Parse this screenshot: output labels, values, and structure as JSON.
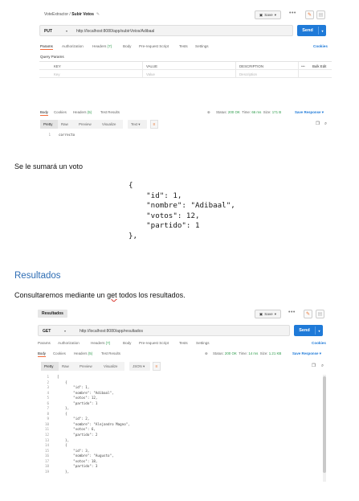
{
  "shot1": {
    "tab_collection": "VoteExtractor",
    "tab_separator": " / ",
    "tab_request": "Subir Votos",
    "save_label": "Save",
    "method": "PUT",
    "url": "http://localhost:8080/app/subirVotos/Adibaal",
    "send_label": "Send",
    "req_tabs": [
      "Params",
      "Authorization",
      "Headers",
      "Body",
      "Pre-request Script",
      "Tests",
      "Settings"
    ],
    "headers_count": "(7)",
    "cookies_label": "Cookies",
    "query_params_label": "Query Params",
    "table_headers": [
      "KEY",
      "VALUE",
      "DESCRIPTION"
    ],
    "bulk_edit": "Bulk Edit",
    "table_placeholders": [
      "Key",
      "Value",
      "Description"
    ],
    "res_tabs": [
      "Body",
      "Cookies",
      "Headers",
      "Test Results"
    ],
    "res_headers_count": "(5)",
    "status_label": "Status:",
    "status_value": "200 OK",
    "time_label": "Time:",
    "time_value": "66 ms",
    "size_label": "Size:",
    "size_value": "171 B",
    "save_response": "Save Response",
    "view_tabs": [
      "Pretty",
      "Raw",
      "Preview",
      "Visualize"
    ],
    "format": "Text",
    "code_line_no": "1",
    "code_line_text": "correcto"
  },
  "doc": {
    "line1": "Se le sumará un voto",
    "json_lines": [
      "{",
      "    \"id\": 1,",
      "    \"nombre\": \"Adibaal\",",
      "    \"votos\": 12,",
      "    \"partido\": 1",
      "},"
    ],
    "heading": "Resultados",
    "para_before": "Consultaremos mediante un ",
    "para_get": "get",
    "para_after": " todos los resultados."
  },
  "shot2": {
    "tab_request": "Resultados",
    "save_label": "Save",
    "method": "GET",
    "url": "http://localhost:8080/app/resultados",
    "send_label": "Send",
    "req_tabs": [
      "Params",
      "Authorization",
      "Headers",
      "Body",
      "Pre-request Script",
      "Tests",
      "Settings"
    ],
    "headers_count": "(7)",
    "cookies_label": "Cookies",
    "res_tabs": [
      "Body",
      "Cookies",
      "Headers",
      "Test Results"
    ],
    "res_headers_count": "(5)",
    "status_label": "Status:",
    "status_value": "200 OK",
    "time_label": "Time:",
    "time_value": "14 ms",
    "size_label": "Size:",
    "size_value": "1.21 KB",
    "save_response": "Save Response",
    "view_tabs": [
      "Pretty",
      "Raw",
      "Preview",
      "Visualize"
    ],
    "format": "JSON",
    "code_lines": [
      {
        "n": "1",
        "t": "["
      },
      {
        "n": "2",
        "t": "    {"
      },
      {
        "n": "3",
        "t": "        \"id\": 1,"
      },
      {
        "n": "4",
        "t": "        \"nombre\": \"Adibaal\","
      },
      {
        "n": "5",
        "t": "        \"votos\": 12,"
      },
      {
        "n": "6",
        "t": "        \"partido\": 1"
      },
      {
        "n": "7",
        "t": "    },"
      },
      {
        "n": "8",
        "t": "    {"
      },
      {
        "n": "9",
        "t": "        \"id\": 2,"
      },
      {
        "n": "10",
        "t": "        \"nombre\": \"Alejandro Magno\","
      },
      {
        "n": "11",
        "t": "        \"votos\": 6,"
      },
      {
        "n": "12",
        "t": "        \"partido\": 2"
      },
      {
        "n": "13",
        "t": "    },"
      },
      {
        "n": "14",
        "t": "    {"
      },
      {
        "n": "15",
        "t": "        \"id\": 3,"
      },
      {
        "n": "16",
        "t": "        \"nombre\": \"Augusto\","
      },
      {
        "n": "17",
        "t": "        \"votos\": 18,"
      },
      {
        "n": "18",
        "t": "        \"partido\": 3"
      },
      {
        "n": "19",
        "t": "    },"
      }
    ]
  },
  "colors": {
    "send": "#1f7ad8",
    "accent_orange": "#f26b3a",
    "status_ok": "#2b9a49",
    "heading": "#2e6db4"
  }
}
